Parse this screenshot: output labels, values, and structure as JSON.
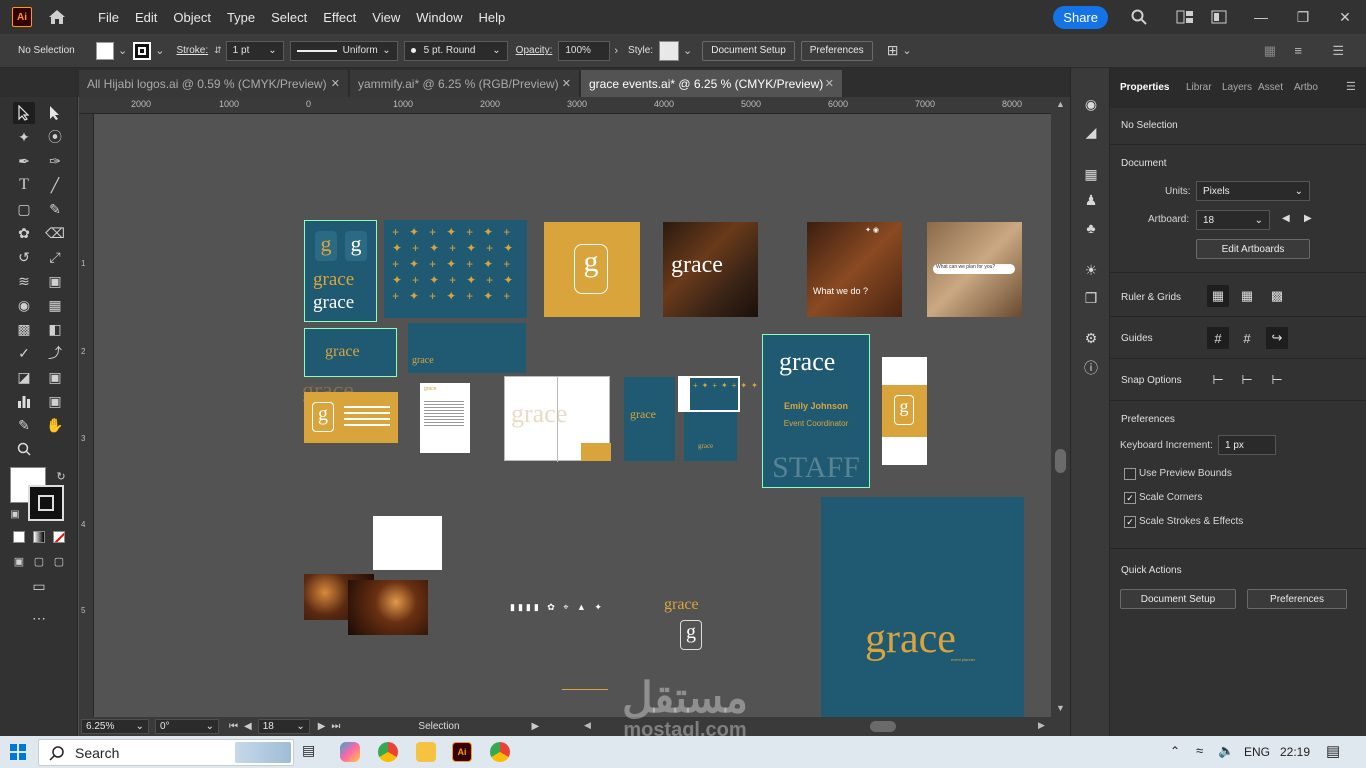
{
  "app": {
    "logo": "Ai",
    "menus": [
      "File",
      "Edit",
      "Object",
      "Type",
      "Select",
      "Effect",
      "View",
      "Window",
      "Help"
    ],
    "share_label": "Share"
  },
  "control_bar": {
    "selection": "No Selection",
    "stroke_label": "Stroke:",
    "stroke_weight": "1 pt",
    "stroke_profile": "Uniform",
    "brush": "5 pt. Round",
    "opacity_label": "Opacity:",
    "opacity": "100%",
    "style_label": "Style:",
    "document_setup": "Document Setup",
    "preferences": "Preferences"
  },
  "tabs": [
    {
      "label": "All Hijabi logos.ai @ 0.59 % (CMYK/Preview)",
      "active": false
    },
    {
      "label": "yammify.ai* @ 6.25 % (RGB/Preview)",
      "active": false
    },
    {
      "label": "grace events.ai* @ 6.25 % (CMYK/Preview)",
      "active": true
    }
  ],
  "ruler": {
    "h_ticks": [
      "2000",
      "1000",
      "0",
      "1000",
      "2000",
      "3000",
      "4000",
      "5000",
      "6000",
      "7000",
      "8000"
    ],
    "v_ticks": [
      "1",
      "2",
      "3",
      "4",
      "5"
    ]
  },
  "canvas": {
    "brand_name": "grace",
    "brand_initial": "g",
    "what_we_do": "What we do ?",
    "search_text": "What can we plan for you?",
    "staff": "STAFF",
    "badge_name": "Emily Johnson",
    "badge_role": "Event Coordinator",
    "tagline": "event planner"
  },
  "status_bar": {
    "zoom": "6.25%",
    "rotation": "0°",
    "artboard": "18",
    "tool": "Selection"
  },
  "panel": {
    "tabs": [
      "Properties",
      "Librar",
      "Layers",
      "Asset",
      "Artbo"
    ],
    "no_selection": "No Selection",
    "document_title": "Document",
    "units_label": "Units:",
    "units_value": "Pixels",
    "artboard_label": "Artboard:",
    "artboard_value": "18",
    "edit_artboards": "Edit Artboards",
    "rulers_grids": "Ruler & Grids",
    "guides": "Guides",
    "snap_options": "Snap Options",
    "preferences_title": "Preferences",
    "keyboard_increment_label": "Keyboard Increment:",
    "keyboard_increment_value": "1 px",
    "use_preview_bounds": "Use Preview Bounds",
    "scale_corners": "Scale Corners",
    "scale_strokes": "Scale Strokes & Effects",
    "quick_actions": "Quick Actions",
    "document_setup": "Document Setup",
    "preferences_btn": "Preferences"
  },
  "taskbar": {
    "search_placeholder": "Search",
    "language": "ENG",
    "time": "22:19"
  },
  "watermark": {
    "arabic": "مستقل",
    "latin": "mostaql.com"
  },
  "colors": {
    "teal": "#1f5a72",
    "gold": "#d9a43b",
    "accent_blue": "#1473e6",
    "ai_orange": "#ff9a00"
  }
}
